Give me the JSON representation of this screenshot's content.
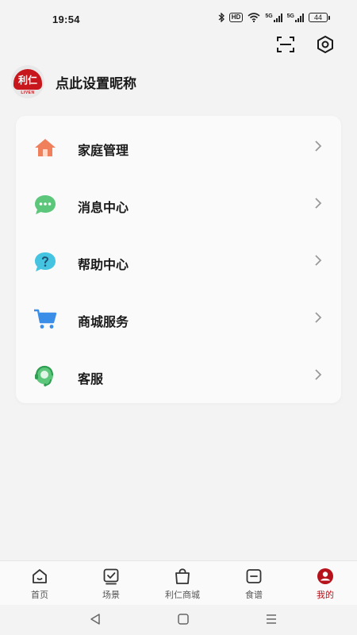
{
  "status_bar": {
    "time": "19:54",
    "hd_badge": "HD",
    "network_label": "5G",
    "battery": "44"
  },
  "top_actions": {
    "scan_icon": "scan-icon",
    "settings_icon": "hexagon-settings-icon"
  },
  "profile": {
    "logo_text": "利仁",
    "logo_subtext": "LIVEN",
    "nickname": "点此设置昵称"
  },
  "menu": {
    "items": [
      {
        "label": "家庭管理",
        "icon": "home-icon",
        "color": "#f0805c"
      },
      {
        "label": "消息中心",
        "icon": "chat-bubble-icon",
        "color": "#5cc77a"
      },
      {
        "label": "帮助中心",
        "icon": "help-icon",
        "color": "#44c4e0"
      },
      {
        "label": "商城服务",
        "icon": "shopping-cart-icon",
        "color": "#3a8ee8"
      },
      {
        "label": "客服",
        "icon": "customer-service-icon",
        "color": "#5cc77a"
      }
    ]
  },
  "bottom_nav": {
    "active_color": "#b5121b",
    "items": [
      {
        "label": "首页",
        "icon": "home-outline-icon"
      },
      {
        "label": "场景",
        "icon": "scene-check-icon"
      },
      {
        "label": "利仁商城",
        "icon": "shopping-bag-icon"
      },
      {
        "label": "食谱",
        "icon": "recipe-icon"
      },
      {
        "label": "我的",
        "icon": "user-profile-icon",
        "active": true
      }
    ]
  },
  "system_nav": {
    "back": "back-triangle-icon",
    "home": "home-square-icon",
    "menu": "menu-lines-icon"
  }
}
